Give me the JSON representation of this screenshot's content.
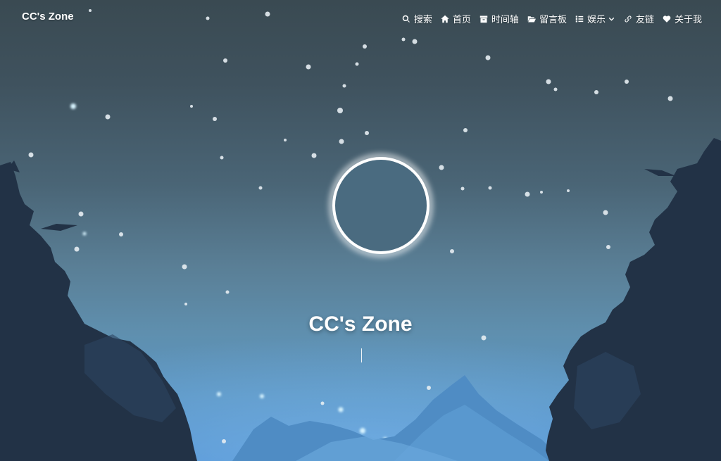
{
  "header": {
    "brand": "CC's Zone"
  },
  "menu": [
    {
      "label": "搜索",
      "icon": "search-icon"
    },
    {
      "label": "首页",
      "icon": "home-icon"
    },
    {
      "label": "时间轴",
      "icon": "archive-icon"
    },
    {
      "label": "留言板",
      "icon": "folder-open-icon"
    },
    {
      "label": "娱乐",
      "icon": "list-icon"
    },
    {
      "label": "友链",
      "icon": "link-icon"
    },
    {
      "label": "关于我",
      "icon": "heart-icon"
    }
  ],
  "hero": {
    "title": "CC's Zone"
  },
  "colors": {
    "sky_top": "#3a4a52",
    "sky_bottom": "#4f8fd0",
    "text": "#ffffff",
    "eclipse_glow": "#ffffff"
  }
}
